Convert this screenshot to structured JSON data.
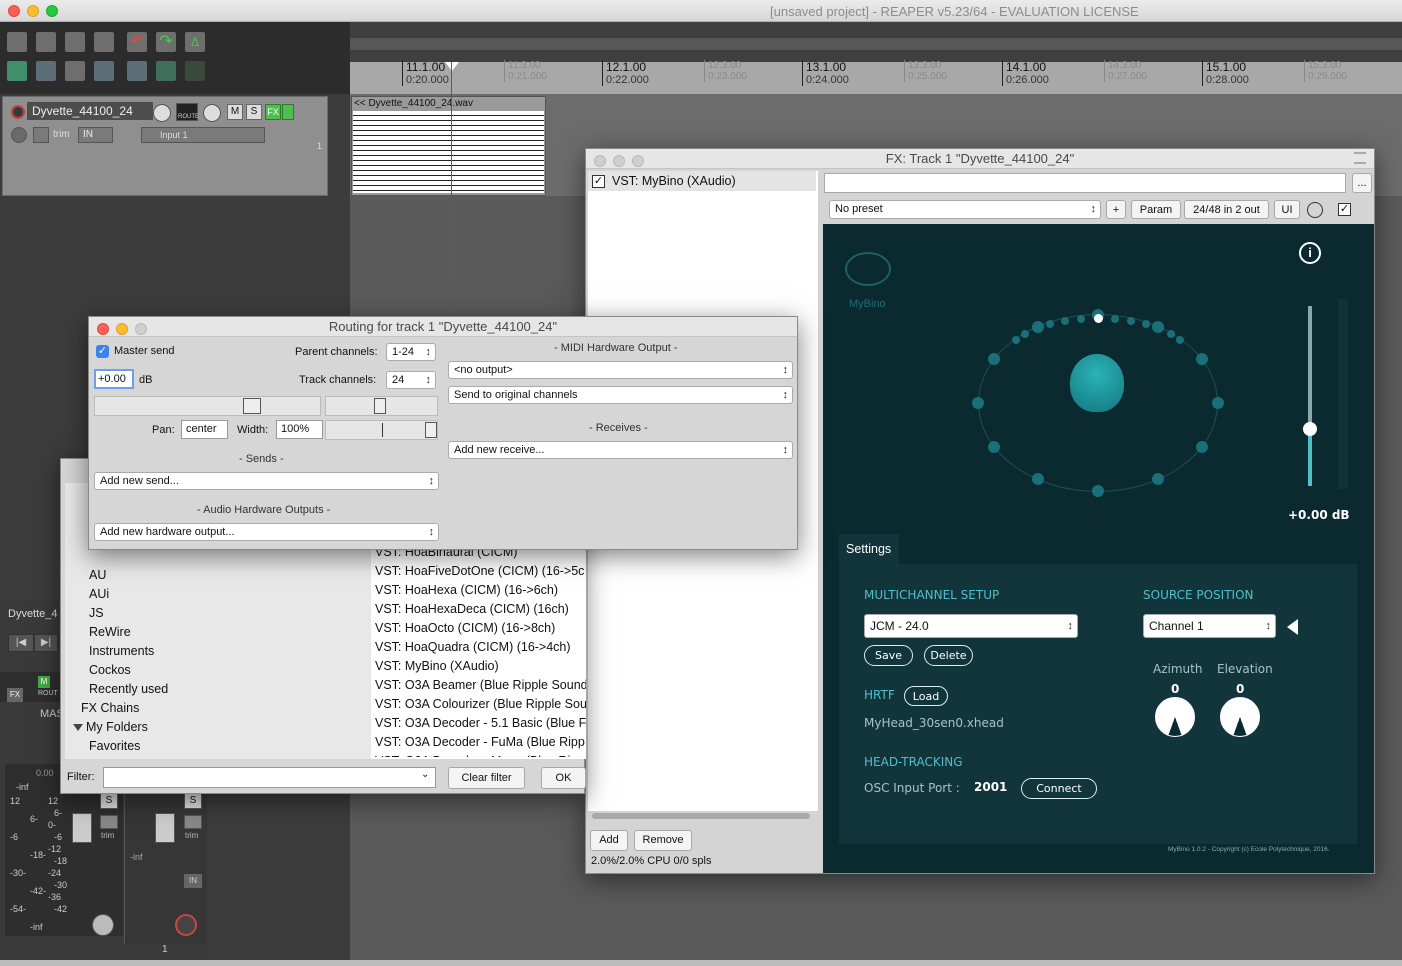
{
  "app": {
    "title": "[unsaved project] - REAPER v5.23/64 - EVALUATION LICENSE"
  },
  "ruler": {
    "major": [
      {
        "bar": "11.1.00",
        "time": "0:20.000"
      },
      {
        "bar": "12.1.00",
        "time": "0:22.000"
      },
      {
        "bar": "13.1.00",
        "time": "0:24.000"
      },
      {
        "bar": "14.1.00",
        "time": "0:26.000"
      },
      {
        "bar": "15.1.00",
        "time": "0:28.000"
      }
    ],
    "minor": [
      {
        "bar": "11.3.00",
        "time": "0:21.000"
      },
      {
        "bar": "12.3.00",
        "time": "0:23.000"
      },
      {
        "bar": "13.3.00",
        "time": "0:25.000"
      },
      {
        "bar": "14.3.00",
        "time": "0:27.000"
      },
      {
        "bar": "15.3.00",
        "time": "0:29.000"
      }
    ]
  },
  "track": {
    "name": "Dyvette_44100_24",
    "mute": "M",
    "solo": "S",
    "fx": "FX",
    "route": "ROUTE",
    "trim": "trim",
    "in": "IN",
    "input": "Input 1",
    "number": "1",
    "item_name": "<< Dyvette_44100_24.wav"
  },
  "fx_window": {
    "title": "FX: Track 1 \"Dyvette_44100_24\"",
    "plugin": "VST: MyBino (XAudio)",
    "preset": "No preset",
    "plus": "+",
    "param": "Param",
    "io": "24/48 in 2 out",
    "ui": "UI",
    "ellipsis": "...",
    "add": "Add",
    "remove": "Remove",
    "cpu": "2.0%/2.0% CPU 0/0 spls"
  },
  "mybino": {
    "logo": "MyBino",
    "info": "i",
    "gain": "+0.00 dB",
    "settings": "Settings",
    "multichannel_label": "MULTICHANNEL SETUP",
    "multichannel_value": "JCM - 24.0",
    "save": "Save",
    "delete": "Delete",
    "source_label": "SOURCE POSITION",
    "source_value": "Channel 1",
    "azimuth_label": "Azimuth",
    "azimuth_value": "0",
    "elevation_label": "Elevation",
    "elevation_value": "0",
    "hrtf_label": "HRTF",
    "load": "Load",
    "hrtf_file": "MyHead_30sen0.xhead",
    "headtracking_label": "HEAD-TRACKING",
    "osc_label": "OSC Input Port :",
    "osc_value": "2001",
    "connect": "Connect",
    "copyright": "MyBino  1.0.2 - Copyright (c) Ecole Polytechnique, 2016."
  },
  "routing": {
    "title": "Routing for track 1 \"Dyvette_44100_24\"",
    "master_send": "Master send",
    "volume": "+0.00",
    "db": "dB",
    "parent_label": "Parent channels:",
    "parent_value": "1-24",
    "track_label": "Track channels:",
    "track_value": "24",
    "pan_label": "Pan:",
    "pan_value": "center",
    "width_label": "Width:",
    "width_value": "100%",
    "sends_header": "- Sends -",
    "add_send": "Add new send...",
    "hw_header": "- Audio Hardware Outputs -",
    "add_hw": "Add new hardware output...",
    "midi_header": "- MIDI Hardware Output -",
    "midi_value": "<no output>",
    "midi_channels": "Send to original channels",
    "receives_header": "- Receives -",
    "add_receive": "Add new receive..."
  },
  "browser": {
    "categories": [
      {
        "label": "AU",
        "indent": 2
      },
      {
        "label": "AUi",
        "indent": 2
      },
      {
        "label": "JS",
        "indent": 2
      },
      {
        "label": "ReWire",
        "indent": 2
      },
      {
        "label": "Instruments",
        "indent": 2
      },
      {
        "label": "Cockos",
        "indent": 2
      },
      {
        "label": "Recently used",
        "indent": 2
      },
      {
        "label": "FX Chains",
        "indent": 1
      },
      {
        "label": "My Folders",
        "indent": 0
      },
      {
        "label": "Favorites",
        "indent": 2
      }
    ],
    "plugins": [
      "VST: HoaBinaural (CICM)",
      "VST: HoaFiveDotOne (CICM) (16->5c",
      "VST: HoaHexa (CICM) (16->6ch)",
      "VST: HoaHexaDeca (CICM) (16ch)",
      "VST: HoaOcto (CICM) (16->8ch)",
      "VST: HoaQuadra (CICM) (16->4ch)",
      "VST: MyBino (XAudio)",
      "VST: O3A Beamer (Blue Ripple Sound",
      "VST: O3A Colourizer (Blue Ripple Sou",
      "VST: O3A Decoder - 5.1 Basic (Blue F",
      "VST: O3A Decoder - FuMa (Blue Ripp",
      "VST: O3A Decoder - Mono (Blue Ripp"
    ],
    "filter_label": "Filter:",
    "clear_filter": "Clear filter",
    "ok": "OK"
  },
  "mixer": {
    "track_name": "Dyvette_4",
    "master_label": "MAS",
    "peak": "0.00",
    "inf": "-inf",
    "scale_left": [
      "12",
      "6-",
      "-6",
      "-18-",
      "-30-",
      "-42-",
      "-54-",
      "-inf"
    ],
    "scale_right": [
      "12",
      "6-",
      "0-",
      "-6",
      "-12",
      "-18",
      "-24",
      "-30",
      "-36",
      "-42"
    ],
    "solo": "S",
    "trim": "trim",
    "in": "IN",
    "fx": "FX",
    "rout": "ROUT",
    "m": "M",
    "inf2": "-inf",
    "track_number": "1"
  }
}
